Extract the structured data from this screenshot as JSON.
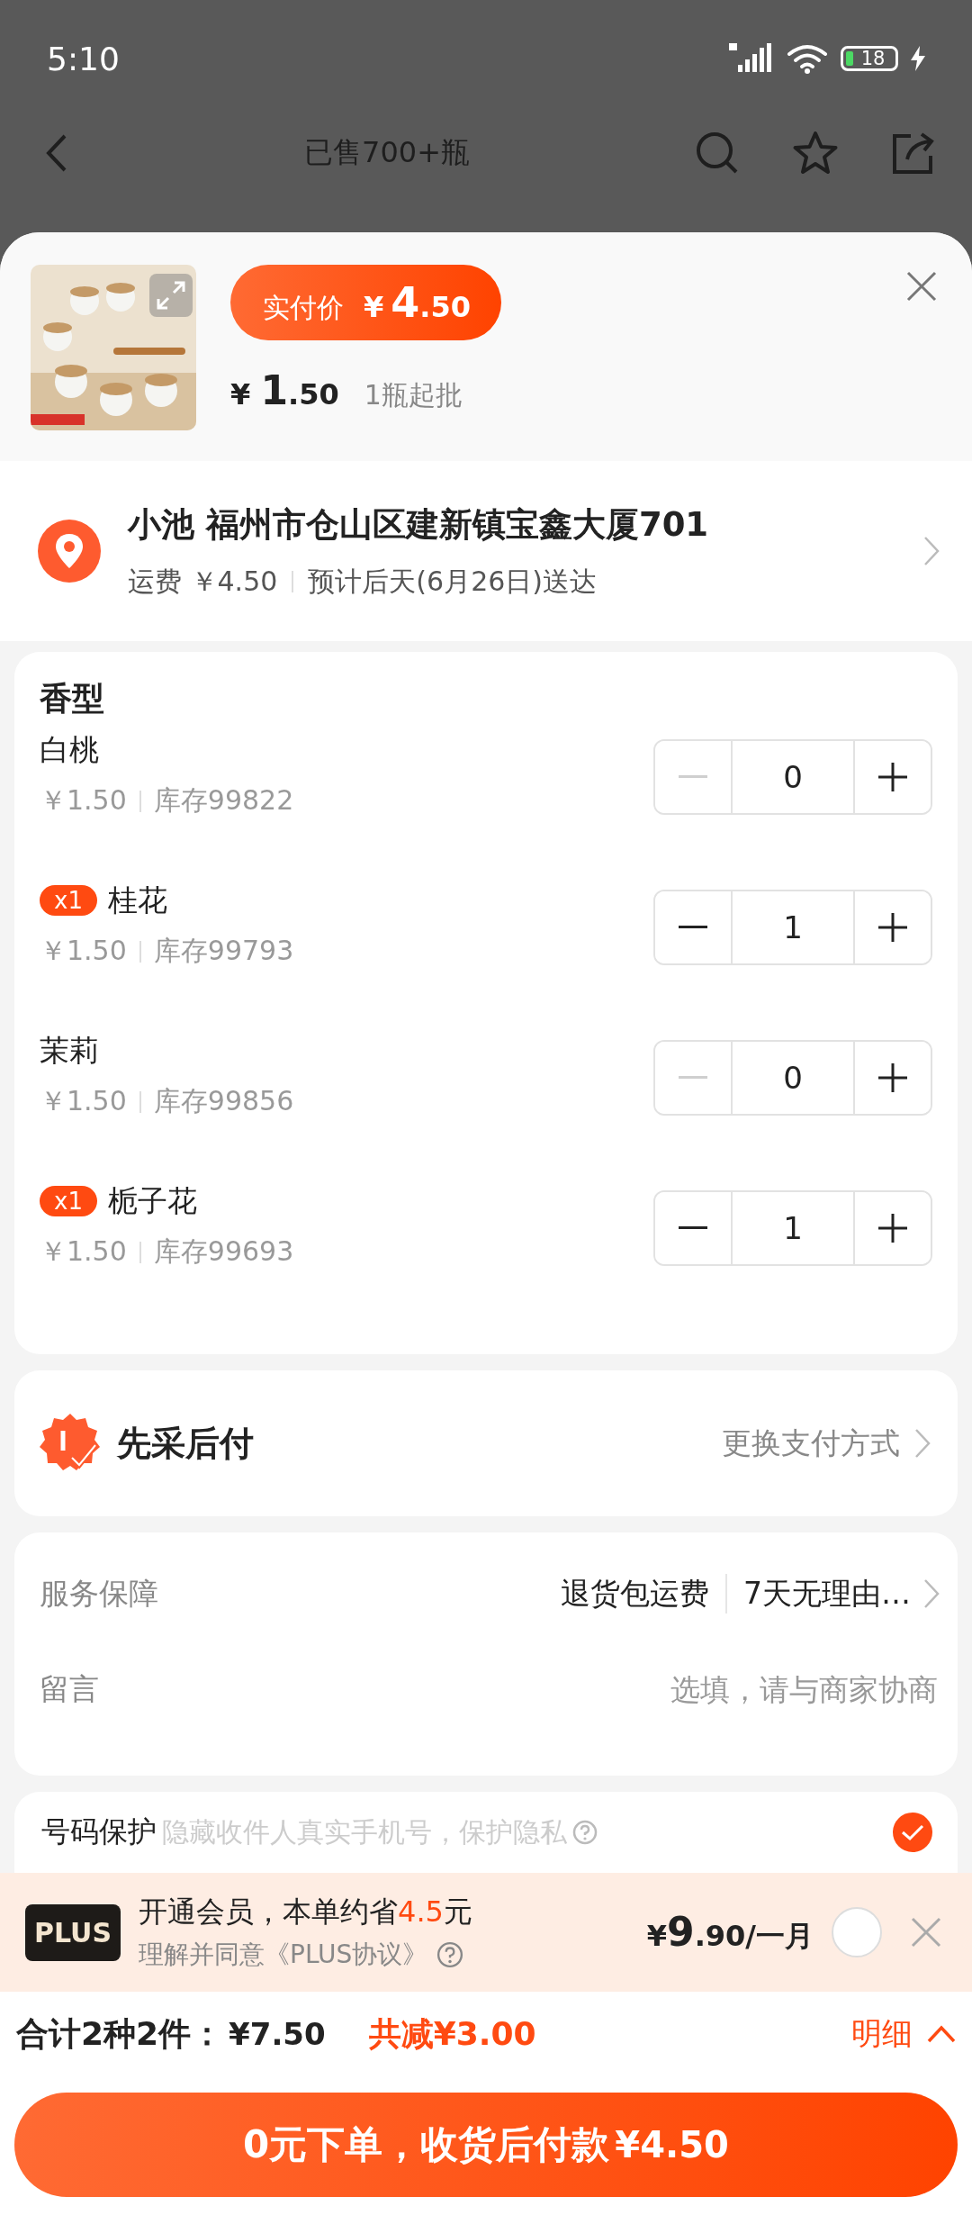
{
  "status_bar": {
    "time": "5:10",
    "battery": "18"
  },
  "nav": {
    "title": "已售700+瓶"
  },
  "product": {
    "pay_label": "实付价",
    "pay_currency": "¥",
    "pay_integer": "4",
    "pay_decimal": ".50",
    "unit_currency": "¥",
    "unit_integer": "1",
    "unit_decimal": ".50",
    "min_order": "1瓶起批"
  },
  "address": {
    "line": "小池 福州市仓山区建新镇宝鑫大厦701",
    "shipping": "运费 ￥4.50",
    "delivery": "预计后天(6月26日)送达"
  },
  "variants": {
    "title": "香型",
    "items": [
      {
        "name": "白桃",
        "price": "￥1.50",
        "stock": "库存99822",
        "qty": "0",
        "minus_disabled": true
      },
      {
        "name": "桂花",
        "price": "￥1.50",
        "stock": "库存99793",
        "qty": "1",
        "badge": "x1",
        "minus_disabled": false
      },
      {
        "name": "茉莉",
        "price": "￥1.50",
        "stock": "库存99856",
        "qty": "0",
        "minus_disabled": true
      },
      {
        "name": "栀子花",
        "price": "￥1.50",
        "stock": "库存99693",
        "qty": "1",
        "badge": "x1",
        "minus_disabled": false
      }
    ]
  },
  "payment": {
    "title": "先采后付",
    "action": "更换支付方式"
  },
  "service": {
    "label": "服务保障",
    "tags": [
      "退货包运费",
      "7天无理由…"
    ],
    "note_label": "留言",
    "note_placeholder": "选填，请与商家协商"
  },
  "privacy": {
    "label": "号码保护",
    "hint": "隐藏收件人真实手机号，保护隐私",
    "checked": true
  },
  "plus": {
    "logo": "PLUS",
    "title": "开通会员，本单约省**4.5**元",
    "agreement": "理解并同意《PLUS协议》",
    "price_currency": "¥",
    "price_integer": "9",
    "price_rest": ".90/一月",
    "selected": false
  },
  "summary": {
    "count": "合计2种2件：",
    "total": "¥7.50",
    "discount_label": "共减",
    "discount": "¥3.00",
    "detail": "明细"
  },
  "submit": {
    "label": "0元下单，收货后付款",
    "amount": "¥4.50"
  }
}
